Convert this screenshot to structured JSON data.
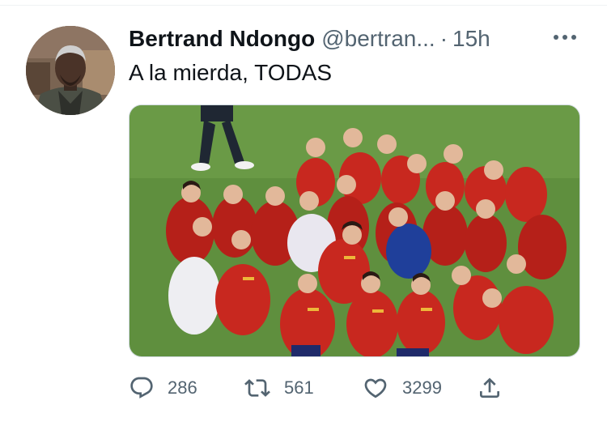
{
  "tweet": {
    "author": {
      "display_name": "Bertrand Ndongo",
      "handle": "@bertran...",
      "separator": "·",
      "time": "15h"
    },
    "text": "A la mierda, TODAS",
    "actions": {
      "reply_count": "286",
      "retweet_count": "561",
      "like_count": "3299"
    }
  },
  "icons": {
    "more": "more-horizontal-icon",
    "reply": "reply-icon",
    "retweet": "retweet-icon",
    "like": "heart-icon",
    "share": "share-icon"
  },
  "colors": {
    "secondary_text": "#536471",
    "primary_text": "#0f1419",
    "divider": "#eff3f4",
    "pitch_green": "#5f8f3e",
    "kit_red": "#c8281f"
  }
}
